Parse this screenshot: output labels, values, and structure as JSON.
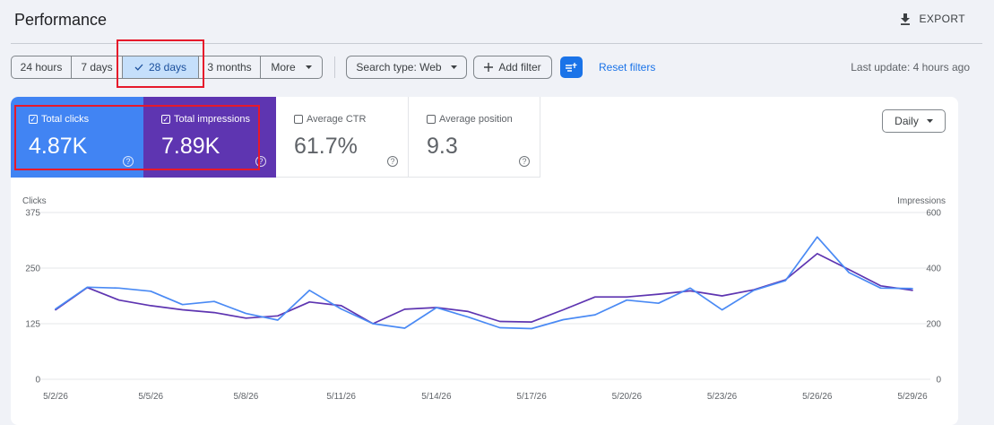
{
  "header": {
    "title": "Performance",
    "export_label": "EXPORT",
    "export_icon": "download-icon"
  },
  "filters": {
    "date_range": {
      "options": [
        "24 hours",
        "7 days",
        "28 days",
        "3 months"
      ],
      "selected": "28 days",
      "more_label": "More"
    },
    "search_type_label": "Search type: Web",
    "add_filter_label": "Add filter",
    "reset_label": "Reset filters",
    "last_update": "Last update: 4 hours ago"
  },
  "metrics": [
    {
      "label": "Total clicks",
      "value": "4.87K",
      "checked": true,
      "color": "#4184f3"
    },
    {
      "label": "Total impressions",
      "value": "7.89K",
      "checked": true,
      "color": "#5e35b1"
    },
    {
      "label": "Average CTR",
      "value": "61.7%",
      "checked": false
    },
    {
      "label": "Average position",
      "value": "9.3",
      "checked": false
    }
  ],
  "granularity": {
    "selected": "Daily"
  },
  "chart_data": {
    "type": "line",
    "left_axis_label": "Clicks",
    "right_axis_label": "Impressions",
    "left_ticks": [
      0,
      125,
      250,
      375
    ],
    "right_ticks": [
      0,
      200,
      400,
      600
    ],
    "left_ylim": [
      0,
      375
    ],
    "right_ylim": [
      0,
      600
    ],
    "x_tick_labels": [
      "5/2/26",
      "5/5/26",
      "5/8/26",
      "5/11/26",
      "5/14/26",
      "5/17/26",
      "5/20/26",
      "5/23/26",
      "5/26/26",
      "5/29/26"
    ],
    "grid": true,
    "series": [
      {
        "name": "Clicks",
        "axis": "left",
        "color": "#4a8af4",
        "values": [
          158,
          207,
          205,
          198,
          168,
          175,
          148,
          133,
          200,
          158,
          125,
          115,
          161,
          140,
          116,
          114,
          134,
          145,
          178,
          171,
          205,
          156,
          200,
          222,
          320,
          240,
          205,
          204
        ]
      },
      {
        "name": "Impressions",
        "axis": "right",
        "color": "#5e35b1",
        "values": [
          250,
          330,
          285,
          265,
          250,
          240,
          220,
          228,
          278,
          265,
          200,
          252,
          258,
          244,
          208,
          206,
          250,
          296,
          296,
          306,
          318,
          300,
          322,
          358,
          452,
          395,
          336,
          320
        ]
      }
    ]
  }
}
